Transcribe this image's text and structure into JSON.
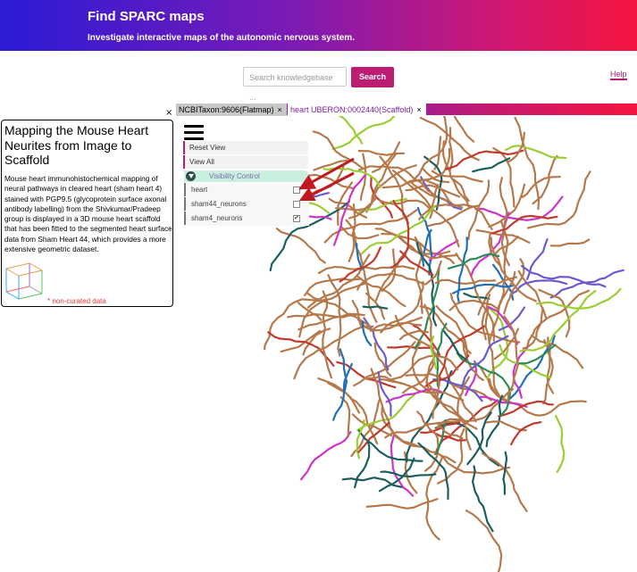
{
  "header": {
    "title": "Find SPARC maps",
    "subtitle": "Investigate interactive maps of the autonomic nervous system."
  },
  "search": {
    "placeholder": "Search knowledgebase ...",
    "button_label": "Search"
  },
  "help_label": "Help",
  "close_glyph": "×",
  "tabs": [
    {
      "label": "NCBITaxon:9606(Flatmap)"
    },
    {
      "label": "heart UBERON:0002440(Scaffold)"
    }
  ],
  "menu": {
    "reset_view": "Reset View",
    "view_all": "View All",
    "visibility_control": "Visibility Control",
    "layers": [
      {
        "label": "heart",
        "checked": false
      },
      {
        "label": "sham44_neurons",
        "checked": false
      },
      {
        "label": "sham4_neurons",
        "checked": true
      }
    ]
  },
  "info_panel": {
    "title": "Mapping the Mouse Heart Neurites from Image to Scaffold",
    "description": "Mouse heart immunohistochemical mapping of neural pathways in cleared heart (sham heart 4) stained with PGP9.5 (glycoprotein surface axonal antibody labelling) from the Shivkumar/Pradeep group is displayed in a 3D mouse heart scaffold that has been fitted to the segmented heart surface data from Sham Heart 44, which provides a more extensive geometric dataset.",
    "note": "* non-curated data"
  },
  "colors": {
    "accent": "#bc1c72",
    "neurite_colors": [
      "#b5784a",
      "#1f6fb5",
      "#6a5acd",
      "#c0392b",
      "#2e8b57",
      "#9acd32",
      "#cc33cc",
      "#1b5e5e"
    ]
  }
}
